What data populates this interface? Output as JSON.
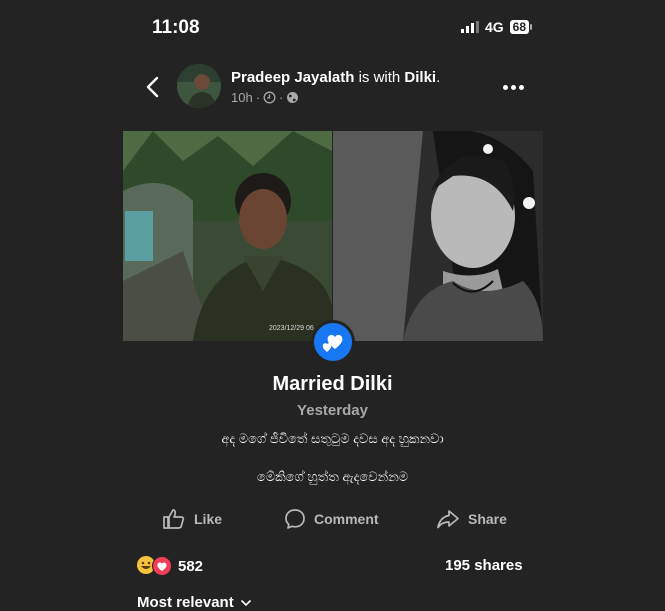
{
  "status_bar": {
    "time": "11:08",
    "network": "4G",
    "battery": "68"
  },
  "post_header": {
    "author": "Pradeep Jayalath",
    "with_text": " is with ",
    "tagged": "Dilki",
    "period": ".",
    "time_ago": "10h",
    "separator": "·"
  },
  "life_event": {
    "title": "Married Dilki",
    "date": "Yesterday",
    "caption_line1": "අද මගේ ජීවිතේ සතුටුම දවස අද හුකනවා",
    "caption_line2": "මේකිගේ හුත්ත ඇදවෙන්නම",
    "photo_stamp": "2023/12/29 06"
  },
  "actions": {
    "like": "Like",
    "comment": "Comment",
    "share": "Share"
  },
  "stats": {
    "reactions_count": "582",
    "shares": "195 shares"
  },
  "comments": {
    "sort_label": "Most relevant"
  },
  "colors": {
    "background": "#232323",
    "accent": "#1877f2"
  }
}
